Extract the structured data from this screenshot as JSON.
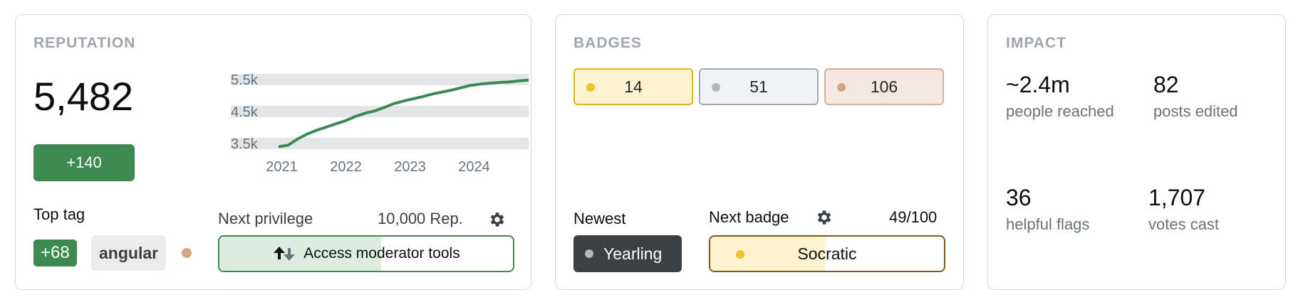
{
  "reputation": {
    "title": "REPUTATION",
    "value": "5,482",
    "delta": "+140",
    "top_tag_label": "Top tag",
    "top_tag_score": "+68",
    "top_tag_name": "angular",
    "next_privilege_label": "Next privilege",
    "next_privilege_rep": "10,000 Rep.",
    "next_privilege_name": "Access moderator tools",
    "next_privilege_progress": 0.55
  },
  "chart_data": {
    "type": "line",
    "x": [
      2020.95,
      2021.1,
      2021.25,
      2021.4,
      2021.55,
      2021.7,
      2021.85,
      2022.0,
      2022.15,
      2022.3,
      2022.45,
      2022.6,
      2022.75,
      2022.9,
      2023.05,
      2023.2,
      2023.35,
      2023.5,
      2023.65,
      2023.8,
      2023.95,
      2024.1,
      2024.25,
      2024.4,
      2024.55,
      2024.7,
      2024.85
    ],
    "values": [
      3400,
      3450,
      3650,
      3800,
      3920,
      4020,
      4120,
      4220,
      4350,
      4450,
      4520,
      4630,
      4750,
      4830,
      4900,
      4970,
      5050,
      5110,
      5170,
      5250,
      5320,
      5360,
      5390,
      5410,
      5430,
      5460,
      5482
    ],
    "ylim": [
      3300,
      5700
    ],
    "xlim": [
      2020.85,
      2024.85
    ],
    "y_ticks": [
      "5.5k",
      "4.5k",
      "3.5k"
    ],
    "x_ticks": [
      "2021",
      "2022",
      "2023",
      "2024"
    ],
    "line_color": "#3d8a51",
    "band_color": "#e3e6e8"
  },
  "badges": {
    "title": "BADGES",
    "gold": {
      "count": "14",
      "color": "#f1c32c"
    },
    "silver": {
      "count": "51",
      "color": "#b4b8bc"
    },
    "bronze": {
      "count": "106",
      "color": "#d1a684"
    },
    "newest_label": "Newest",
    "newest_name": "Yearling",
    "next_label": "Next badge",
    "next_name": "Socratic",
    "next_progress_text": "49/100",
    "next_progress": 0.49
  },
  "impact": {
    "title": "IMPACT",
    "stats": [
      {
        "value": "~2.4m",
        "label": "people reached"
      },
      {
        "value": "82",
        "label": "posts edited"
      },
      {
        "value": "36",
        "label": "helpful flags"
      },
      {
        "value": "1,707",
        "label": "votes cast"
      }
    ]
  }
}
